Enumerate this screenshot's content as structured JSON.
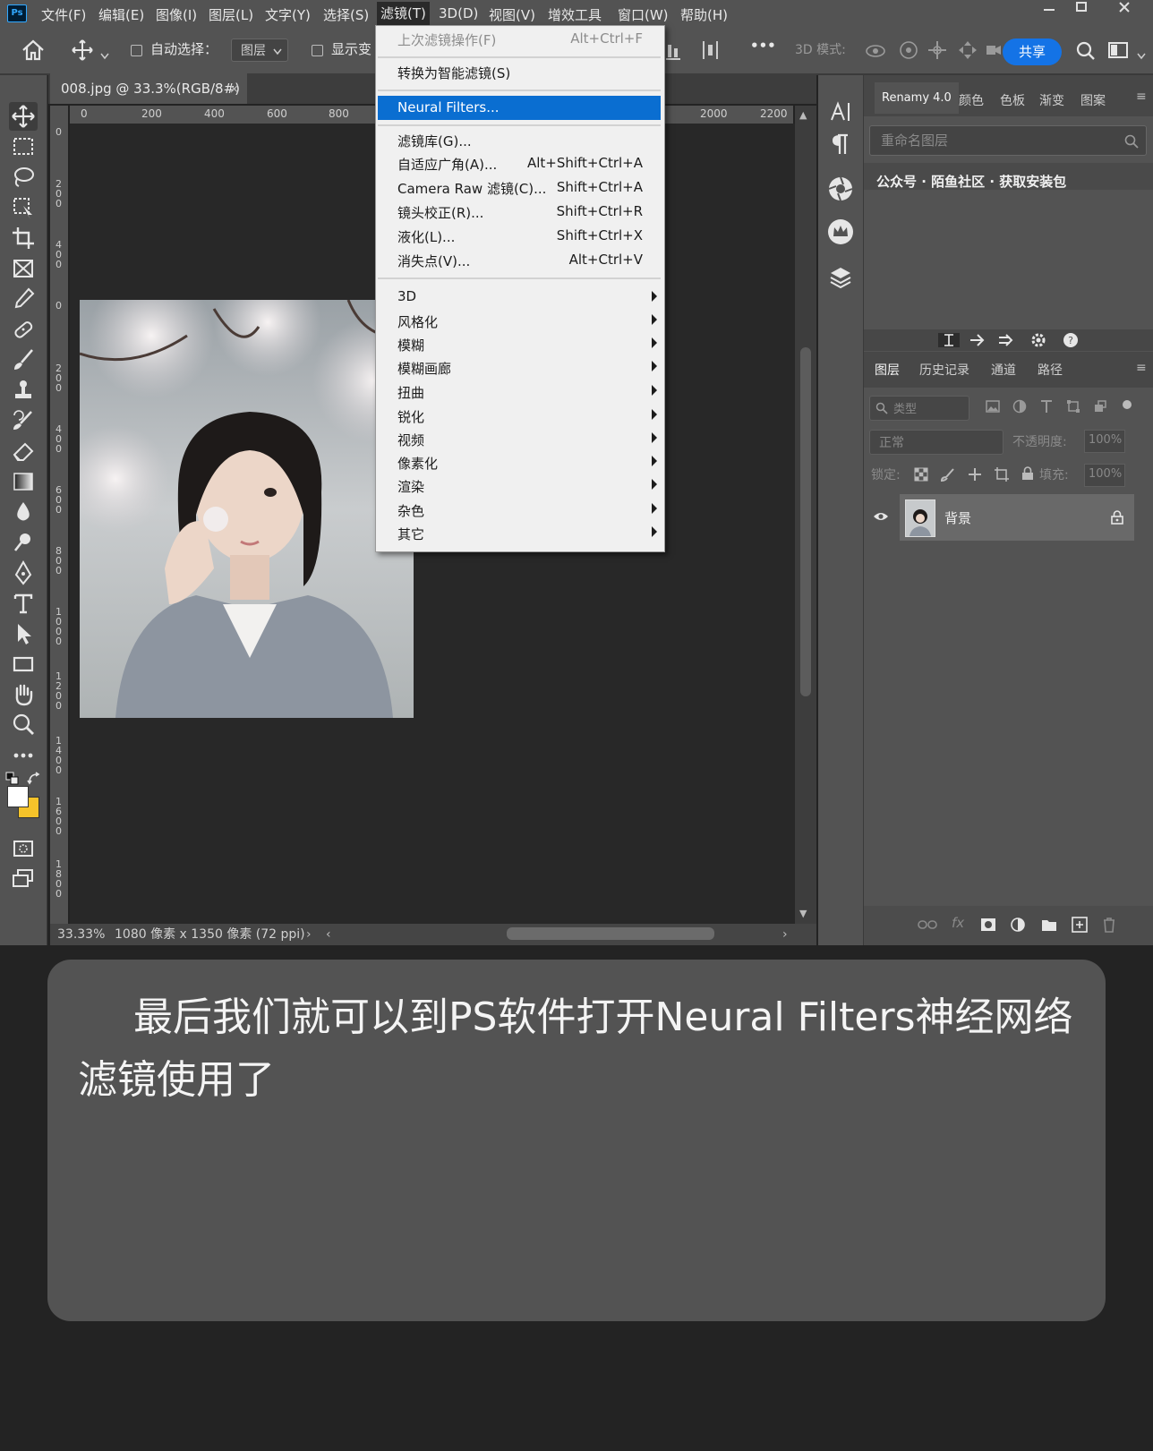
{
  "menubar": {
    "logo": "Ps",
    "items": [
      "文件(F)",
      "编辑(E)",
      "图像(I)",
      "图层(L)",
      "文字(Y)",
      "选择(S)",
      "滤镜(T)",
      "3D(D)",
      "视图(V)",
      "增效工具",
      "窗口(W)",
      "帮助(H)"
    ],
    "active_item": "滤镜(T)"
  },
  "optionsbar": {
    "auto_select_label": "自动选择：",
    "auto_select_target": "图层",
    "show_transform_label": "显示变",
    "mode_3d_label": "3D 模式:",
    "more": "•••",
    "share_label": "共享"
  },
  "document": {
    "tab_title": "008.jpg @ 33.3%(RGB/8#)",
    "ruler_h_ticks": [
      "0",
      "200",
      "400",
      "600",
      "800",
      "2000",
      "2200"
    ],
    "ruler_v_ticks": [
      "0",
      "200",
      "400",
      "0",
      "200",
      "400",
      "600",
      "800",
      "1000",
      "1200",
      "1400",
      "1600",
      "1800"
    ],
    "zoom": "33.33%",
    "doc_info": "1080 像素 x 1350 像素 (72 ppi)"
  },
  "filter_menu": {
    "items": [
      {
        "label": "上次滤镜操作(F)",
        "shortcut": "Alt+Ctrl+F",
        "disabled": true
      },
      {
        "label": "转换为智能滤镜(S)",
        "shortcut": "",
        "disabled": false
      },
      {
        "label": "Neural Filters...",
        "shortcut": "",
        "highlighted": true
      },
      {
        "label": "滤镜库(G)...",
        "shortcut": ""
      },
      {
        "label": "自适应广角(A)...",
        "shortcut": "Alt+Shift+Ctrl+A"
      },
      {
        "label": "Camera Raw 滤镜(C)...",
        "shortcut": "Shift+Ctrl+A"
      },
      {
        "label": "镜头校正(R)...",
        "shortcut": "Shift+Ctrl+R"
      },
      {
        "label": "液化(L)...",
        "shortcut": "Shift+Ctrl+X"
      },
      {
        "label": "消失点(V)...",
        "shortcut": "Alt+Ctrl+V"
      },
      {
        "label": "3D",
        "submenu": true
      },
      {
        "label": "风格化",
        "submenu": true
      },
      {
        "label": "模糊",
        "submenu": true
      },
      {
        "label": "模糊画廊",
        "submenu": true
      },
      {
        "label": "扭曲",
        "submenu": true
      },
      {
        "label": "锐化",
        "submenu": true
      },
      {
        "label": "视频",
        "submenu": true
      },
      {
        "label": "像素化",
        "submenu": true
      },
      {
        "label": "渲染",
        "submenu": true
      },
      {
        "label": "杂色",
        "submenu": true
      },
      {
        "label": "其它",
        "submenu": true
      }
    ]
  },
  "right_panel": {
    "top_tabs": [
      "Renamy 4.0",
      "颜色",
      "色板",
      "渐变",
      "图案"
    ],
    "rename_placeholder": "重命名图层",
    "promo_text": "公众号 · 陌鱼社区 · 获取安装包",
    "layer_tabs": [
      "图层",
      "历史记录",
      "通道",
      "路径"
    ],
    "filter_kind": "类型",
    "blend_mode": "正常",
    "opacity_label": "不透明度:",
    "opacity_value": "100%",
    "lock_label": "锁定:",
    "fill_label": "填充:",
    "fill_value": "100%",
    "layer_name": "背景",
    "bottom_fx": "fx"
  },
  "caption": {
    "text": "最后我们就可以到PS软件打开Neural Filters神经网络滤镜使用了"
  },
  "colors": {
    "accent_blue": "#1473e6",
    "menu_highlight": "#0a6ed1",
    "background_color_swatch": "#f5c32a"
  }
}
